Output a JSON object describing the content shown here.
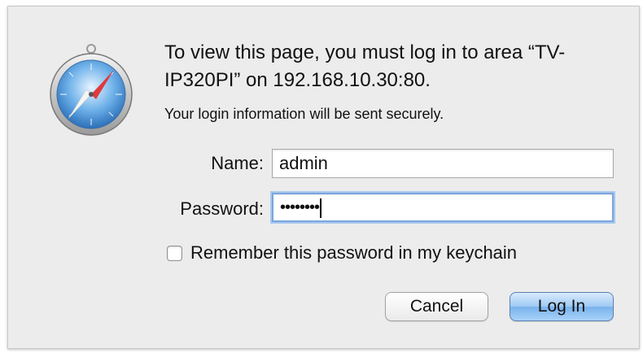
{
  "dialog": {
    "message": "To view this page, you must log in to area “TV-IP320PI” on 192.168.10.30:80.",
    "subtext": "Your login information will be sent securely.",
    "app_icon": "safari-compass-icon"
  },
  "form": {
    "name_label": "Name:",
    "name_value": "admin",
    "password_label": "Password:",
    "password_value": "••••••••",
    "remember_label": "Remember this password in my keychain",
    "remember_checked": false
  },
  "buttons": {
    "cancel_label": "Cancel",
    "login_label": "Log In"
  },
  "colors": {
    "dialog_bg": "#ececec",
    "focus_ring": "#7aa6dc",
    "default_button": "#79b2ec"
  }
}
